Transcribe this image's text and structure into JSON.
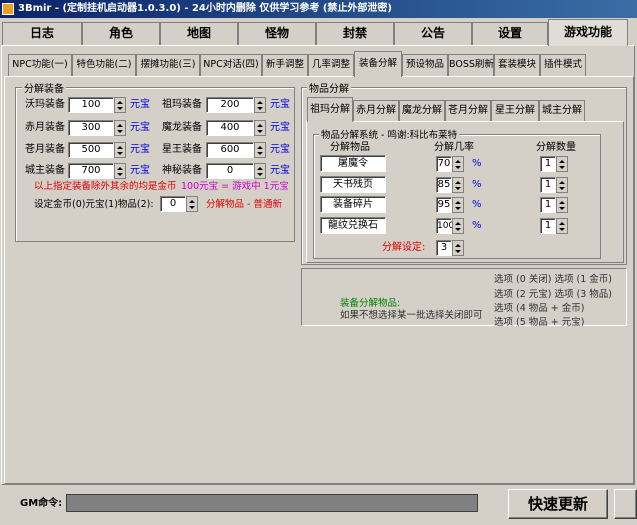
{
  "window": {
    "title": "3Bmir - (定制挂机启动器1.0.3.0) - 24小时内删除  仅供学习参考 (禁止外部泄密)"
  },
  "main_tabs": [
    "日志",
    "角色",
    "地图",
    "怪物",
    "封禁",
    "公告",
    "设置",
    "游戏功能"
  ],
  "sub_tabs": [
    "NPC功能(一)",
    "特色功能(二)",
    "摆摊功能(三)",
    "NPC对话(四)",
    "新手调整",
    "几率调整",
    "装备分解",
    "预设物品",
    "BOSS刷新",
    "套装模块",
    "插件模式"
  ],
  "decompose_equip": {
    "title": "分解装备",
    "rows": [
      {
        "left_label": "沃玛装备",
        "left_value": "100",
        "left_unit": "元宝",
        "right_label": "祖玛装备",
        "right_value": "200",
        "right_unit": "元宝"
      },
      {
        "left_label": "赤月装备",
        "left_value": "300",
        "left_unit": "元宝",
        "right_label": "魔龙装备",
        "right_value": "400",
        "right_unit": "元宝"
      },
      {
        "left_label": "苍月装备",
        "left_value": "500",
        "left_unit": "元宝",
        "right_label": "星王装备",
        "right_value": "600",
        "right_unit": "元宝"
      },
      {
        "left_label": "城主装备",
        "left_value": "700",
        "left_unit": "元宝",
        "right_label": "神秘装备",
        "right_value": "0",
        "right_unit": "元宝"
      }
    ],
    "note_red": "以上指定装备除外其余的均是金币",
    "note_mag": "100元宝 = 游戏中 1元宝",
    "setting_label": "设定金币(0)元宝(1)物品(2):",
    "setting_value": "0",
    "setting_result": "分解物品 - 普通新"
  },
  "item_decompose": {
    "title": "物品分解",
    "tabs": [
      "祖玛分解",
      "赤月分解",
      "魔龙分解",
      "苍月分解",
      "星王分解",
      "城主分解"
    ],
    "system_title": "物品分解系统 - 鸣谢:科比布莱特",
    "col_item": "分解物品",
    "col_rate": "分解几率",
    "col_qty": "分解数量",
    "rows": [
      {
        "item": "屠魔令",
        "rate": "70",
        "unit": "%",
        "qty": "1"
      },
      {
        "item": "天书残页",
        "rate": "85",
        "unit": "%",
        "qty": "1"
      },
      {
        "item": "装备碎片",
        "rate": "95",
        "unit": "%",
        "qty": "1"
      },
      {
        "item": "龍纹兑换石",
        "rate": "100",
        "unit": "%",
        "qty": "1"
      }
    ],
    "setting_label": "分解设定:",
    "setting_value": "3",
    "options": [
      "选项 (0 关闭)  选项 (1 金币)",
      "选项 (2 元宝)  选项 (3 物品)",
      "选项 (4 物品 + 金币)",
      "选项 (5 物品 + 元宝)"
    ],
    "hint_title": "装备分解物品:",
    "hint_text": "如果不想选择某一批选择关闭即可"
  },
  "bottom": {
    "gm_label": "GM命令:",
    "update_button": "快速更新"
  },
  "colors": {
    "titlebar": "#0a246a",
    "yuanbao": "#0000e0",
    "warning": "#e00000",
    "magenta": "#d000d0",
    "hint": "#008000"
  }
}
